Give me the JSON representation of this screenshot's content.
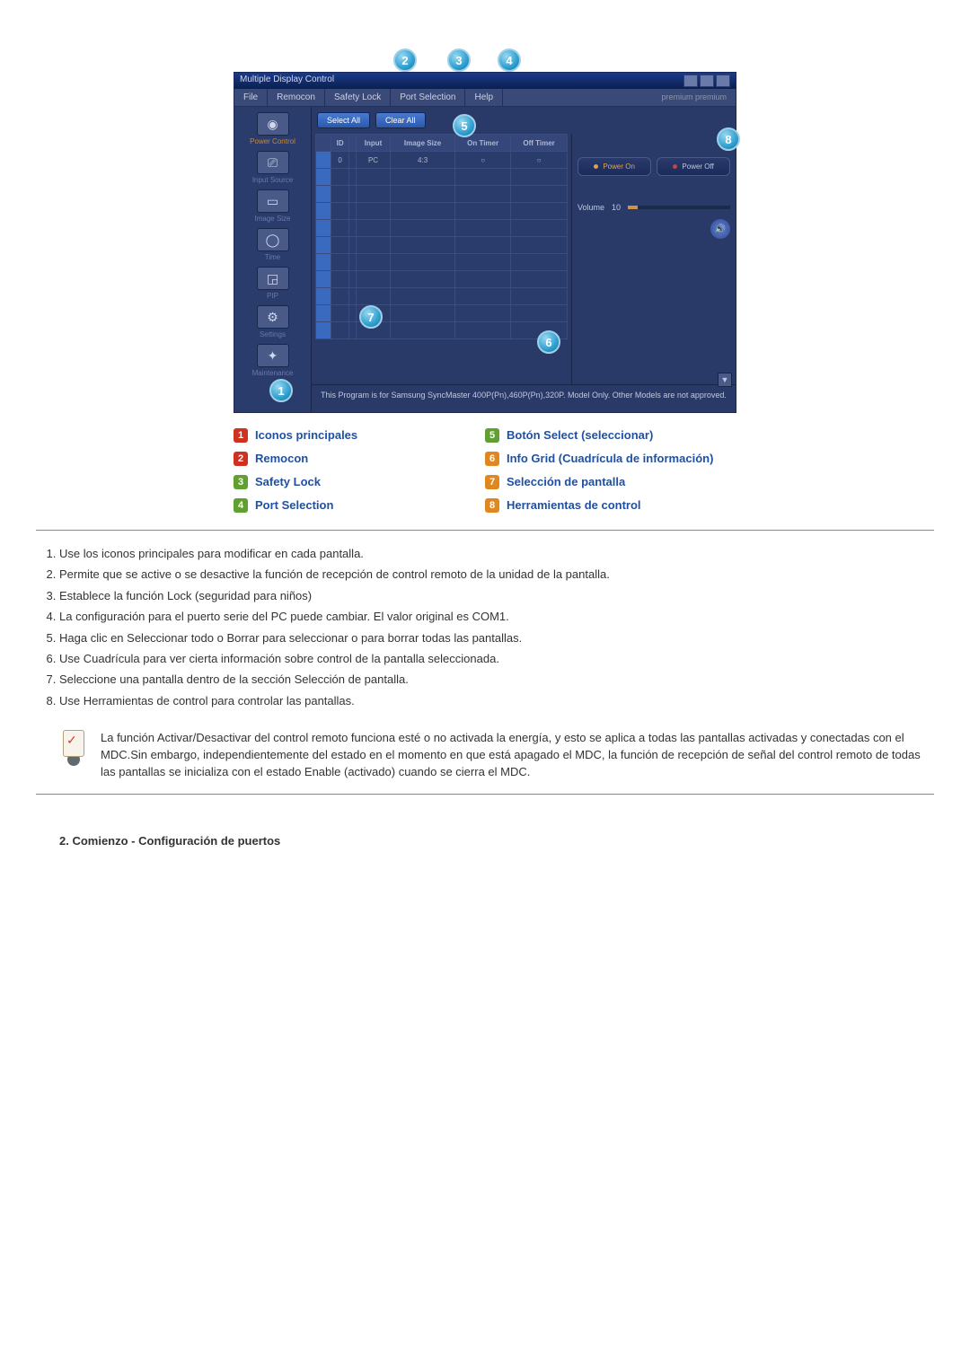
{
  "app": {
    "title": "Multiple Display Control",
    "statusText": "premium premium",
    "menu": [
      "File",
      "Remocon",
      "Safety Lock",
      "Port Selection",
      "Help"
    ],
    "toolbar": {
      "selectAll": "Select All",
      "clearAll": "Clear All"
    },
    "sidebar": [
      {
        "label": "Power Control",
        "active": true
      },
      {
        "label": "Input Source"
      },
      {
        "label": "Image Size"
      },
      {
        "label": "Time"
      },
      {
        "label": "PIP"
      },
      {
        "label": "Settings"
      },
      {
        "label": "Maintenance"
      }
    ],
    "gridHeaders": [
      "",
      "ID",
      "",
      "Input",
      "Image Size",
      "On Timer",
      "Off Timer"
    ],
    "gridFirstRow": [
      "",
      "0",
      "",
      "PC",
      "4:3",
      "○",
      "○"
    ],
    "control": {
      "powerOn": "Power On",
      "powerOff": "Power Off",
      "volumeLabel": "Volume",
      "volumeValue": "10"
    },
    "footer": "This Program is for Samsung SyncMaster 400P(Pn),460P(Pn),320P. Model Only. Other Models are not approved."
  },
  "legend": {
    "left": [
      {
        "n": "1",
        "cls": "red",
        "label": "Iconos principales"
      },
      {
        "n": "2",
        "cls": "red",
        "label": "Remocon"
      },
      {
        "n": "3",
        "cls": "green",
        "label": "Safety Lock"
      },
      {
        "n": "4",
        "cls": "green",
        "label": "Port Selection"
      }
    ],
    "right": [
      {
        "n": "5",
        "cls": "green",
        "label": "Botón Select (seleccionar)"
      },
      {
        "n": "6",
        "cls": "orange",
        "label": "Info Grid (Cuadrícula de información)"
      },
      {
        "n": "7",
        "cls": "orange",
        "label": "Selección de pantalla"
      },
      {
        "n": "8",
        "cls": "orange",
        "label": "Herramientas de control"
      }
    ]
  },
  "list": [
    "Use los iconos principales para modificar en cada pantalla.",
    "Permite que se active o se desactive la función de recepción de control remoto de la unidad de la pantalla.",
    "Establece la función Lock (seguridad para niños)",
    "La configuración para el puerto serie del PC puede cambiar. El valor original es COM1.",
    "Haga clic en Seleccionar todo o Borrar para seleccionar o para borrar todas las pantallas.",
    "Use Cuadrícula para ver cierta información sobre control de la pantalla seleccionada.",
    "Seleccione una pantalla dentro de la sección Selección de pantalla.",
    "Use Herramientas de control para controlar las pantallas."
  ],
  "note": "La función Activar/Desactivar del control remoto funciona esté o no activada la energía, y esto se aplica a todas las pantallas activadas y conectadas con el MDC.Sin embargo, independientemente del estado en el momento en que está apagado el MDC, la función de recepción de señal del control remoto de todas las pantallas se inicializa con el estado Enable (activado) cuando se cierra el MDC.",
  "heading2": "2. Comienzo - Configuración de puertos"
}
